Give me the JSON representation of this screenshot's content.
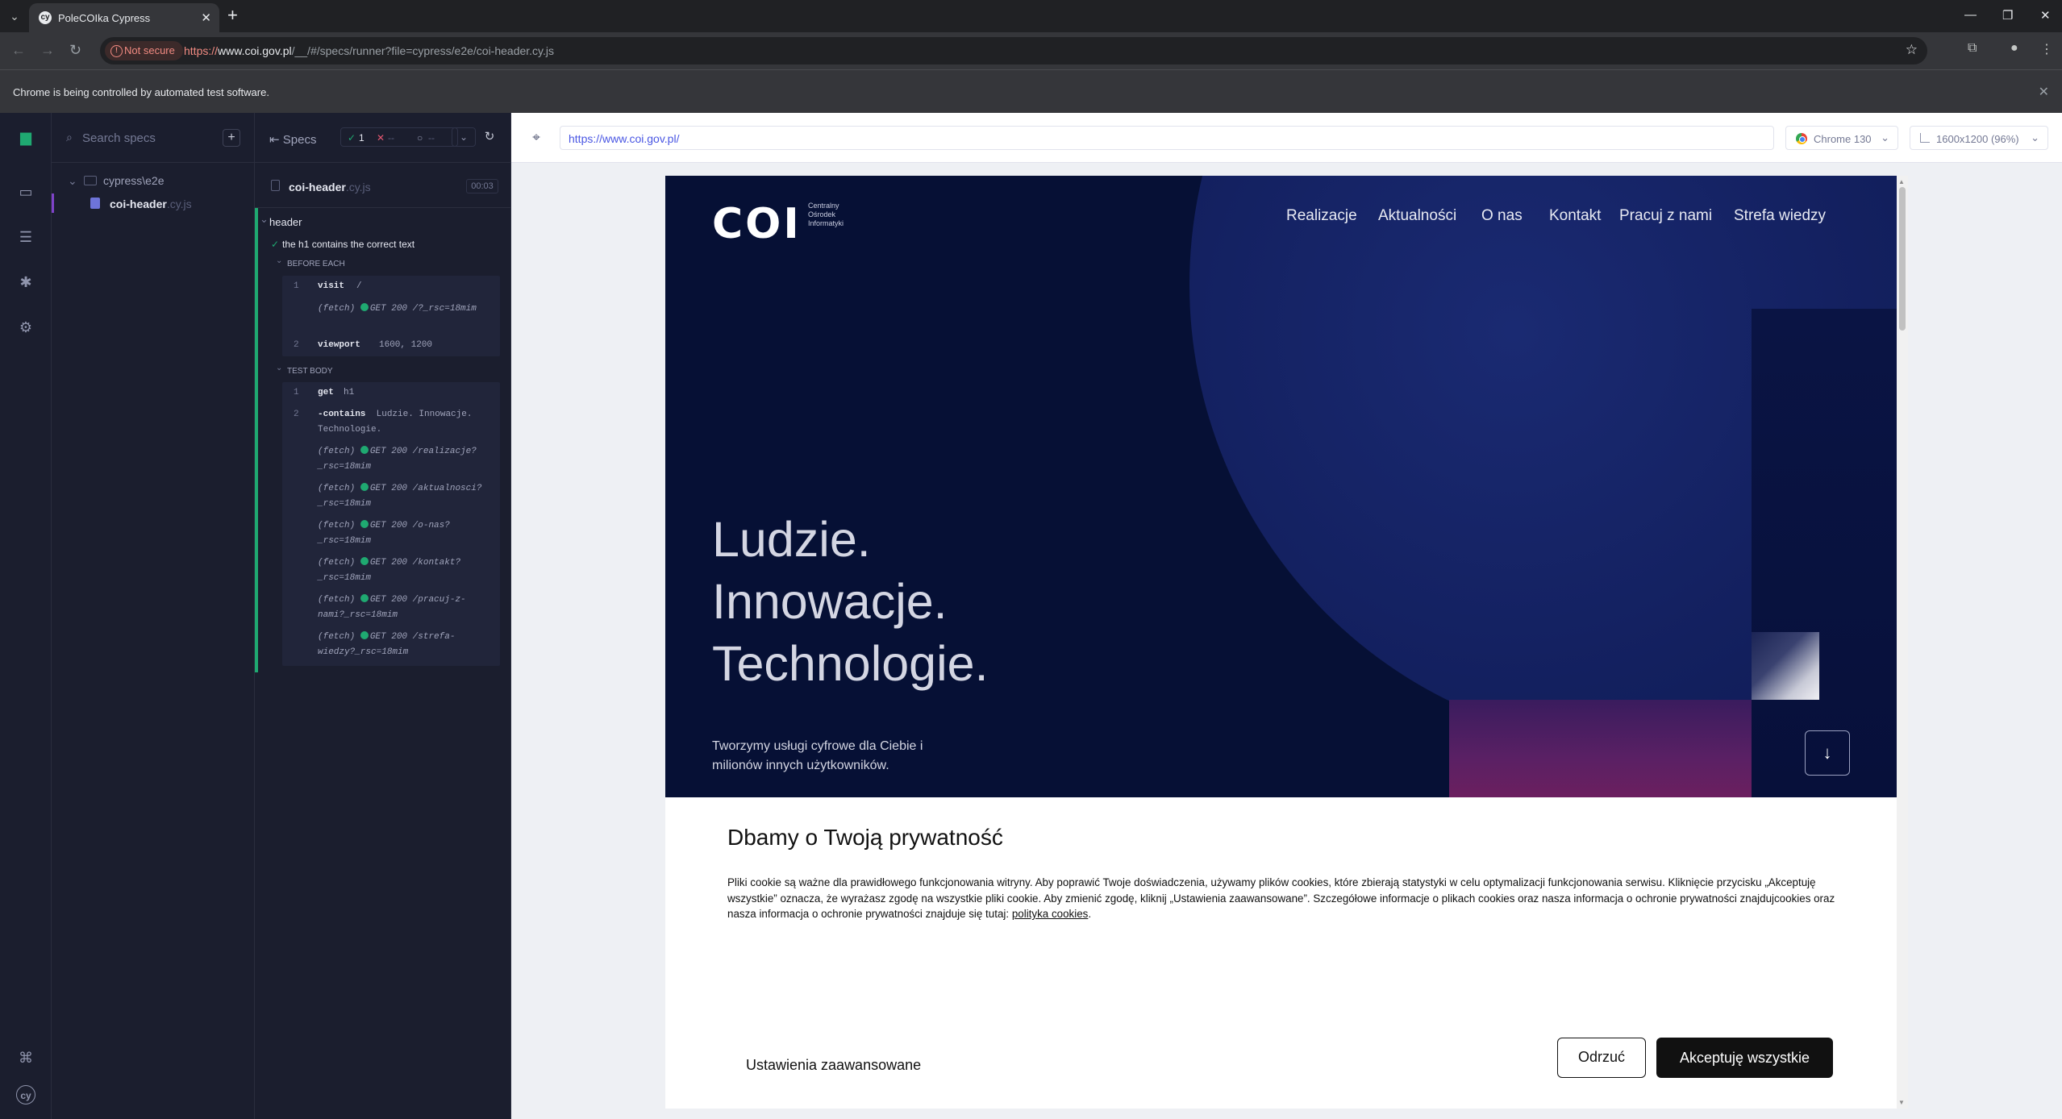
{
  "browser": {
    "tab_title": "PoleCOIka Cypress",
    "security_label": "Not secure",
    "url_scheme": "https://",
    "url_host": "www.coi.gov.pl",
    "url_path": "/__/#/specs/runner?file=cypress/e2e/coi-header.cy.js",
    "infobar_message": "Chrome is being controlled by automated test software."
  },
  "sidebar": {
    "search_placeholder": "Search specs",
    "folder": "cypress\\e2e",
    "file_name": "coi-header",
    "file_ext": ".cy.js"
  },
  "reporter": {
    "specs_label": "Specs",
    "passed": "1",
    "failed": "--",
    "pending": "--",
    "spec_name": "coi-header",
    "spec_ext": ".cy.js",
    "duration": "00:03",
    "suite": "header",
    "test": "the h1 contains the correct text",
    "before_each_label": "BEFORE EACH",
    "test_body_label": "TEST BODY",
    "before_each": [
      {
        "num": "1",
        "name": "visit",
        "arg": "/"
      },
      {
        "fetch": "(fetch)",
        "text": "GET 200 /?_rsc=18mim"
      },
      {
        "num": "2",
        "name": "viewport",
        "arg": "1600, 1200"
      }
    ],
    "body": [
      {
        "num": "1",
        "name": "get",
        "arg": "h1"
      },
      {
        "num": "2",
        "name": "-contains",
        "arg": "Ludzie. Innowacje. Technologie."
      },
      {
        "fetch": "(fetch)",
        "text": "GET 200 /realizacje?_rsc=18mim"
      },
      {
        "fetch": "(fetch)",
        "text": "GET 200 /aktualnosci?_rsc=18mim"
      },
      {
        "fetch": "(fetch)",
        "text": "GET 200 /o-nas?_rsc=18mim"
      },
      {
        "fetch": "(fetch)",
        "text": "GET 200 /kontakt?_rsc=18mim"
      },
      {
        "fetch": "(fetch)",
        "text": "GET 200 /pracuj-z-nami?_rsc=18mim"
      },
      {
        "fetch": "(fetch)",
        "text": "GET 200 /strefa-wiedzy?_rsc=18mim"
      }
    ]
  },
  "aut": {
    "url": "https://www.coi.gov.pl/",
    "browser": "Chrome 130",
    "viewport": "1600x1200 (96%)"
  },
  "site": {
    "logo": "COI",
    "logo_sub": [
      "Centralny",
      "Ośrodek",
      "Informatyki"
    ],
    "nav": [
      "Realizacje",
      "Aktualności",
      "O nas",
      "Kontakt",
      "Pracuj z nami",
      "Strefa wiedzy"
    ],
    "hero_title": [
      "Ludzie.",
      "Innowacje.",
      "Technologie."
    ],
    "hero_desc": "Tworzymy usługi cyfrowe dla Ciebie  i milionów innych użytkowników.",
    "colors": {
      "hero_bg": "#061035",
      "accent_magenta": "#6b1f5f"
    }
  },
  "cookie": {
    "title": "Dbamy o Twoją prywatność",
    "text": "Pliki cookie są ważne dla prawidłowego funkcjonowania witryny. Aby poprawić Twoje doświadczenia, używamy plików cookies, które zbierają statystyki w celu optymalizacji funkcjonowania serwisu. Kliknięcie przycisku „Akceptuję wszystkie” oznacza, że wyrażasz zgodę na wszystkie pliki cookie. Aby zmienić zgodę, kliknij „Ustawienia zaawansowane”. Szczegółowe informacje o plikach cookies oraz nasza informacja o ochronie prywatności znajdujcookies oraz nasza informacja o ochronie prywatności znajduje się tutaj:",
    "link": "polityka cookies",
    "advanced": "Ustawienia zaawansowane",
    "reject": "Odrzuć",
    "accept": "Akceptuję wszystkie"
  }
}
